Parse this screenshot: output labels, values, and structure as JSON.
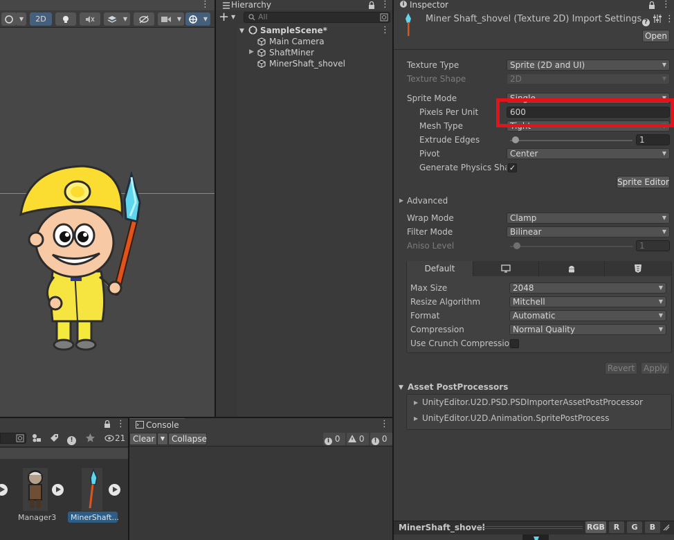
{
  "scene": {
    "toolbar": {
      "mode_2d": "2D"
    }
  },
  "hierarchy": {
    "title": "Hierarchy",
    "search_placeholder": "All",
    "scene_name": "SampleScene*",
    "items": [
      {
        "label": "Main Camera"
      },
      {
        "label": "ShaftMiner"
      },
      {
        "label": "MinerShaft_shovel"
      }
    ]
  },
  "inspector": {
    "title": "Inspector",
    "asset_title": "Miner Shaft_shovel (Texture 2D) Import Settings",
    "open_label": "Open",
    "texture_type_label": "Texture Type",
    "texture_type_value": "Sprite (2D and UI)",
    "texture_shape_label": "Texture Shape",
    "texture_shape_value": "2D",
    "sprite_mode_label": "Sprite Mode",
    "sprite_mode_value": "Single",
    "pixels_per_unit_label": "Pixels Per Unit",
    "pixels_per_unit_value": "600",
    "mesh_type_label": "Mesh Type",
    "mesh_type_value": "Tight",
    "extrude_edges_label": "Extrude Edges",
    "extrude_edges_value": "1",
    "pivot_label": "Pivot",
    "pivot_value": "Center",
    "gen_physics_label": "Generate Physics Shape",
    "sprite_editor_label": "Sprite Editor",
    "advanced_label": "Advanced",
    "wrap_mode_label": "Wrap Mode",
    "wrap_mode_value": "Clamp",
    "filter_mode_label": "Filter Mode",
    "filter_mode_value": "Bilinear",
    "aniso_label": "Aniso Level",
    "aniso_value": "1",
    "platform_tabs": {
      "default": "Default"
    },
    "max_size_label": "Max Size",
    "max_size_value": "2048",
    "resize_label": "Resize Algorithm",
    "resize_value": "Mitchell",
    "format_label": "Format",
    "format_value": "Automatic",
    "compression_label": "Compression",
    "compression_value": "Normal Quality",
    "crunch_label": "Use Crunch Compression",
    "revert_label": "Revert",
    "apply_label": "Apply",
    "postprocessors_label": "Asset PostProcessors",
    "postprocessors": [
      "UnityEditor.U2D.PSD.PSDImporterAssetPostProcessor",
      "UnityEditor.U2D.Animation.SpritePostProcess"
    ],
    "preview_name": "MinerShaft_shovel",
    "channels": [
      "RGB",
      "R",
      "G",
      "B"
    ]
  },
  "project": {
    "hidden_count": "21",
    "assets": [
      {
        "label": "Manager3"
      },
      {
        "label": "MinerShaft..."
      }
    ]
  },
  "console": {
    "title": "Console",
    "clear_label": "Clear",
    "collapse_label": "Collapse",
    "info_count": "0",
    "warning_count": "0",
    "error_count": "0"
  },
  "colors": {
    "highlight": "#e2141b",
    "selected_tab": "#46607c"
  }
}
